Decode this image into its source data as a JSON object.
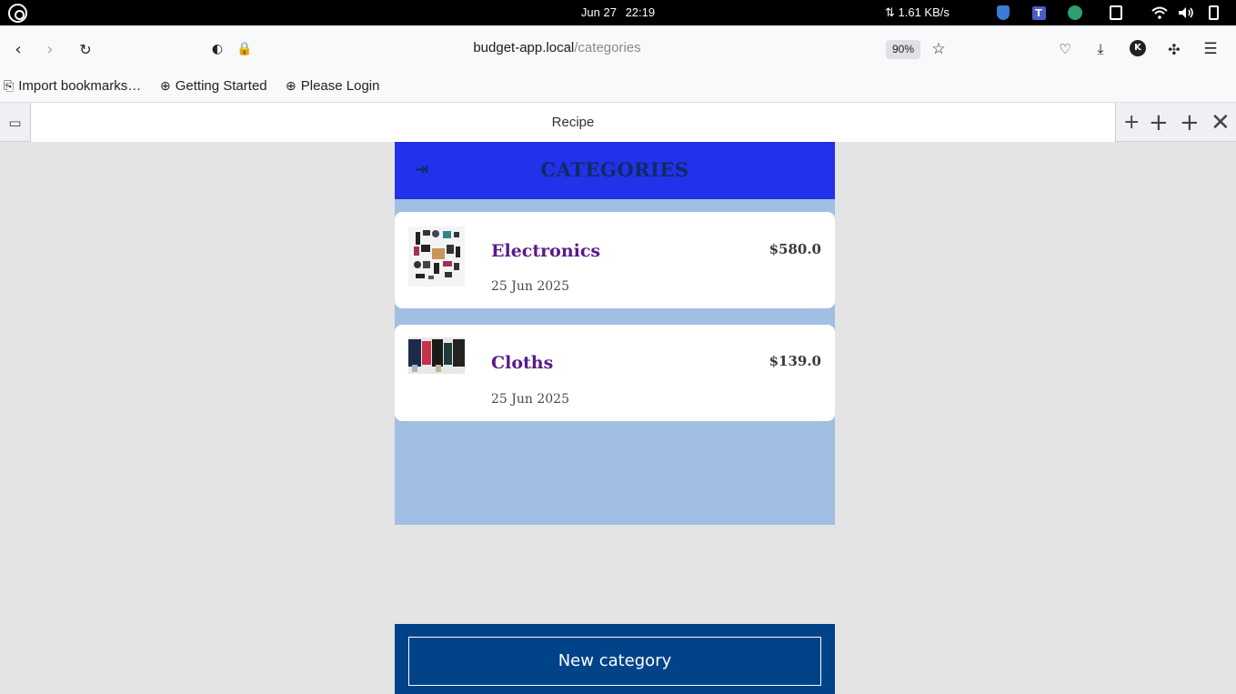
{
  "os": {
    "date": "Jun 27",
    "time": "22:19",
    "network_speed": "⇅ 1.61 KB/s",
    "tray_t2_label": "T"
  },
  "browser": {
    "url_host": "budget-app.local",
    "url_path": "/categories",
    "zoom": "90%",
    "account_initial": "K",
    "bookmarks": [
      "Import bookmarks…",
      "Getting Started",
      "Please Login"
    ],
    "tab_title": "Recipe"
  },
  "app": {
    "title": "CATEGORIES",
    "categories": [
      {
        "name": "Electronics",
        "date": "25 Jun 2025",
        "total": "$580.0"
      },
      {
        "name": "Cloths",
        "date": "25 Jun 2025",
        "total": "$139.0"
      }
    ],
    "new_category_label": "New category"
  },
  "colors": {
    "header": "#2231ea",
    "body": "#a1bfe2",
    "footer": "#004389",
    "category_name": "#5a198a"
  }
}
